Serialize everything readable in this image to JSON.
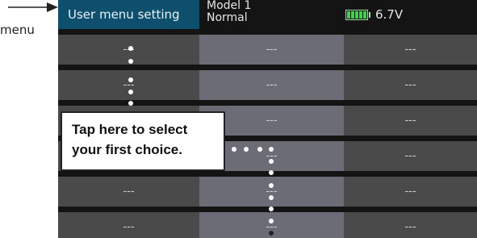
{
  "annotation": {
    "side_label": "menu"
  },
  "header": {
    "menu_title": "User menu setting",
    "model_name": "Model 1",
    "condition": "Normal",
    "battery_voltage": "6.7V"
  },
  "grid": {
    "rows": [
      [
        "---",
        "---",
        "---"
      ],
      [
        "---",
        "---",
        "---"
      ],
      [
        "---",
        "---",
        "---"
      ],
      [
        "---",
        "---",
        "---"
      ],
      [
        "---",
        "---",
        "---"
      ],
      [
        "---",
        "---",
        "---"
      ]
    ]
  },
  "callout": {
    "line1": "Tap here to select",
    "line2": "your first choice."
  },
  "colors": {
    "title_bg": "#0f4f6e",
    "selected_column": "#6c6c77",
    "cell": "#4a4a4a",
    "battery": "#3cd24a"
  },
  "icons": {
    "pointer": "arrow-right-icon",
    "battery": "battery-icon"
  }
}
